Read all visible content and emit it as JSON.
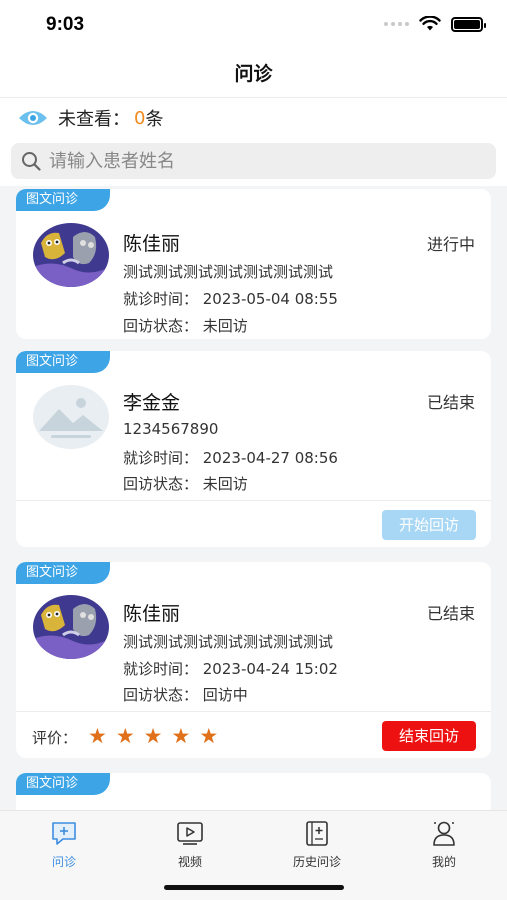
{
  "status_bar": {
    "time": "9:03"
  },
  "nav": {
    "title": "问诊"
  },
  "unread": {
    "label": "未查看：",
    "count": "0",
    "unit": "条"
  },
  "search": {
    "placeholder": "请输入患者姓名",
    "value": ""
  },
  "consultations": [
    {
      "tag": "图文问诊",
      "name": "陈佳丽",
      "status": "进行中",
      "line1": "测试测试测试测试测试测试测试",
      "visit_time": "就诊时间：  2023-05-04 08:55",
      "followup_status": "回访状态：  未回访"
    },
    {
      "tag": "图文问诊",
      "name": "李金金",
      "status": "已结束",
      "line1": "1234567890",
      "visit_time": "就诊时间：  2023-04-27 08:56",
      "followup_status": "回访状态：  未回访",
      "action_label": "开始回访"
    },
    {
      "tag": "图文问诊",
      "name": "陈佳丽",
      "status": "已结束",
      "line1": "测试测试测试测试测试测试测试",
      "visit_time": "就诊时间：  2023-04-24 15:02",
      "followup_status": "回访状态：  回访中",
      "rating_label": "评价：",
      "rating": 5,
      "action_label": "结束回访"
    },
    {
      "tag": "图文问诊"
    }
  ],
  "tabs": [
    {
      "label": "问诊",
      "icon": "chat-consult-icon",
      "active": true
    },
    {
      "label": "视频",
      "icon": "video-icon",
      "active": false
    },
    {
      "label": "历史问诊",
      "icon": "history-record-icon",
      "active": false
    },
    {
      "label": "我的",
      "icon": "profile-icon",
      "active": false
    }
  ],
  "colors": {
    "accent_blue": "#3da5e6",
    "count_orange": "#f08a1c",
    "star": "#e0701a",
    "end_button": "#ee1111",
    "disabled_button": "#a7d7f4",
    "active_tab": "#3d8ee0"
  }
}
